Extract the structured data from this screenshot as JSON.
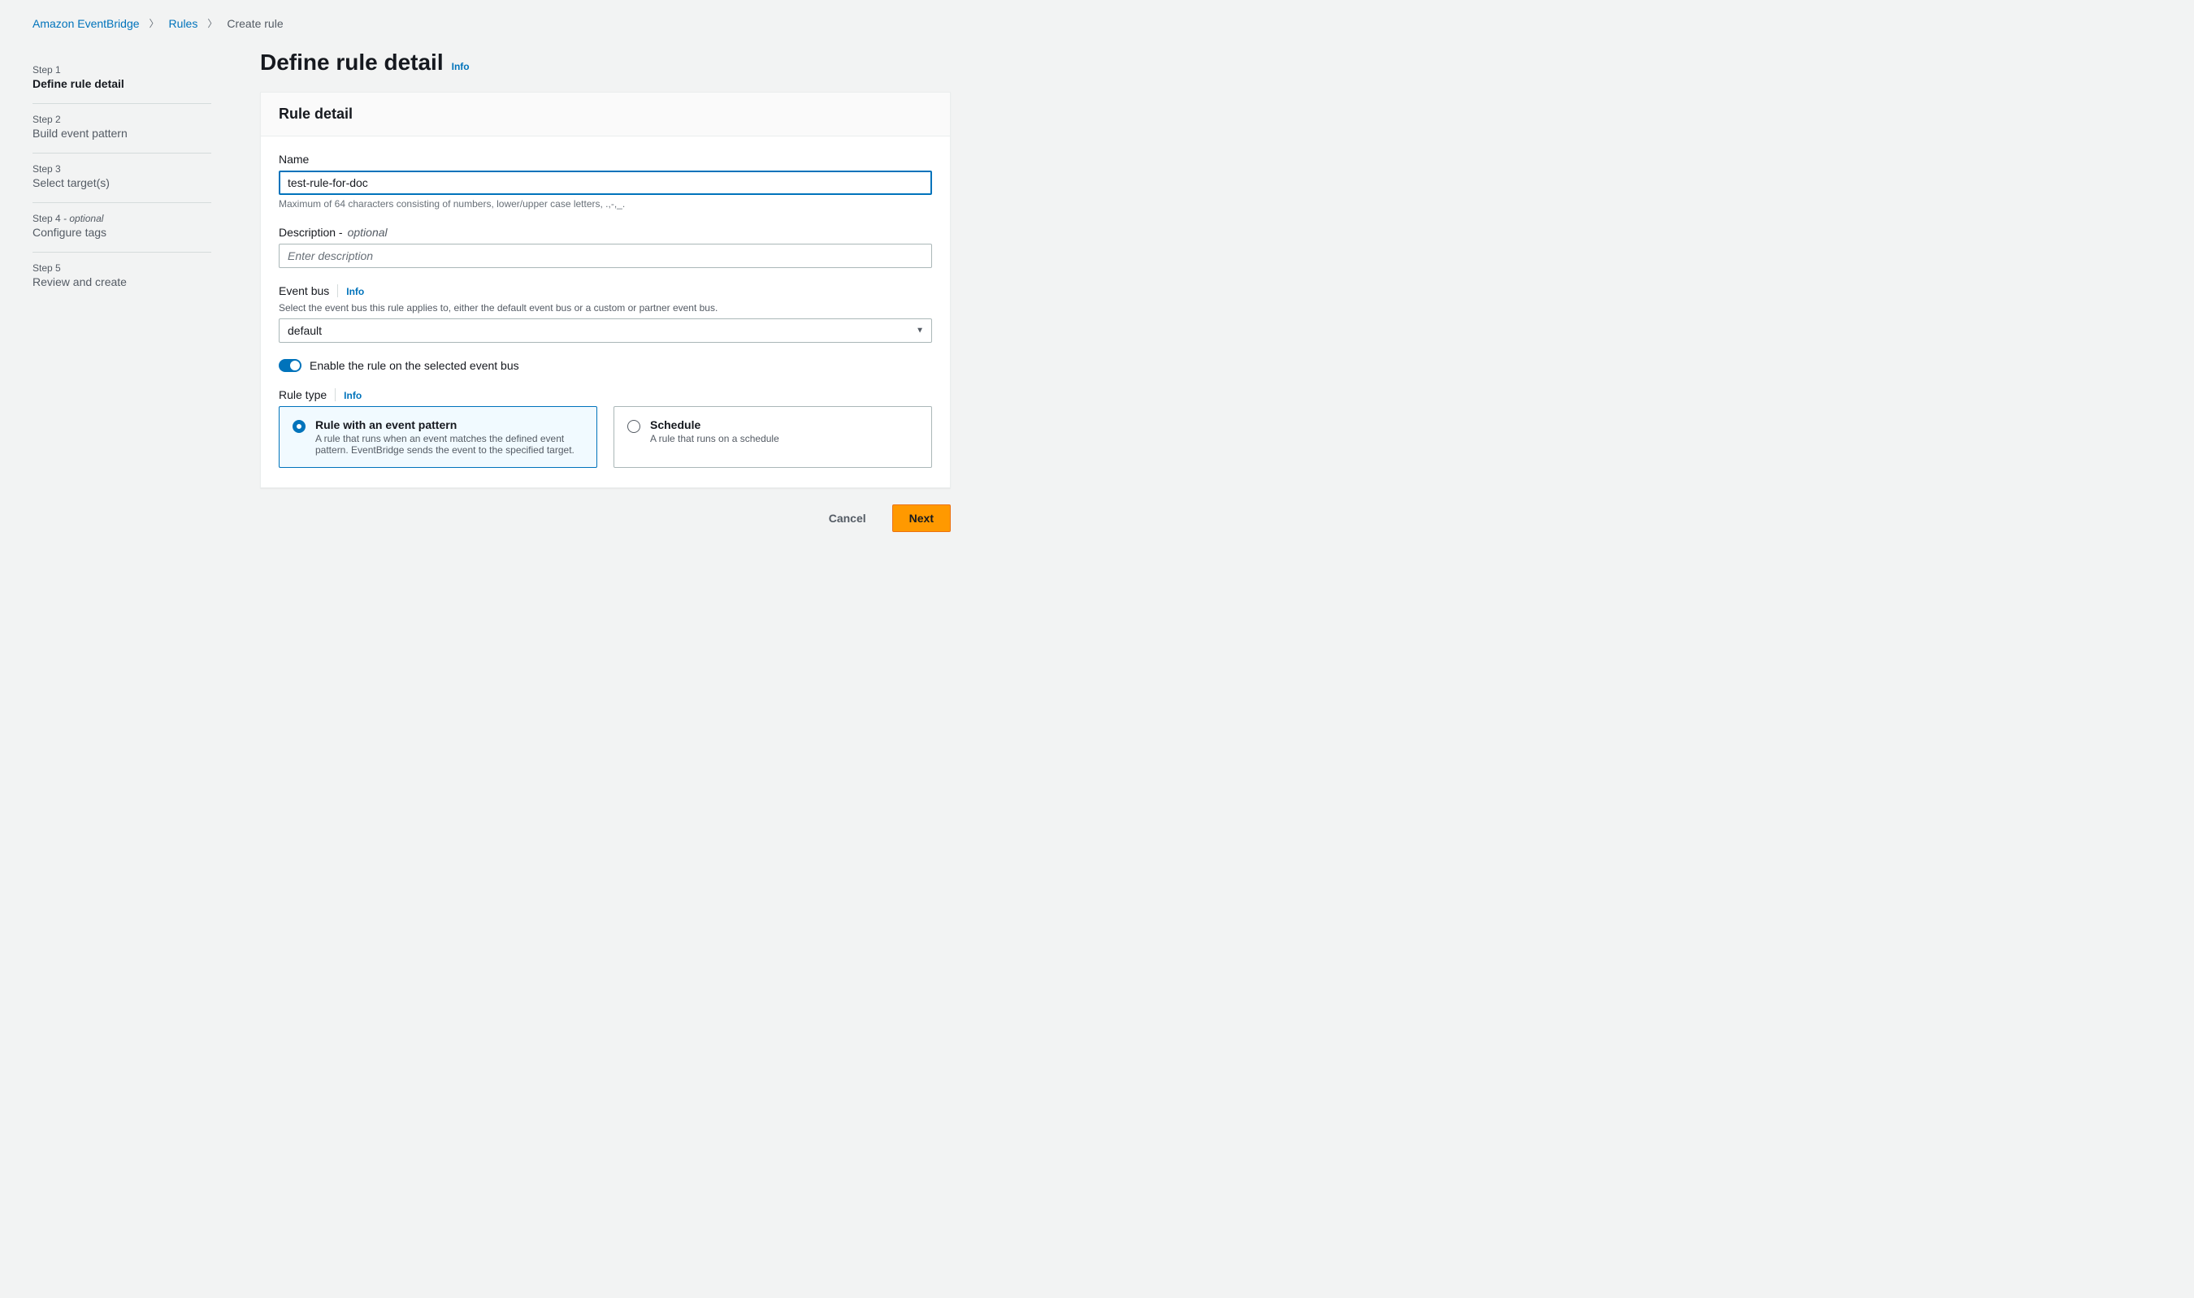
{
  "breadcrumb": {
    "items": [
      {
        "label": "Amazon EventBridge",
        "link": true
      },
      {
        "label": "Rules",
        "link": true
      },
      {
        "label": "Create rule",
        "link": false
      }
    ]
  },
  "steps": [
    {
      "label": "Step 1",
      "optional": "",
      "title": "Define rule detail",
      "active": true
    },
    {
      "label": "Step 2",
      "optional": "",
      "title": "Build event pattern",
      "active": false
    },
    {
      "label": "Step 3",
      "optional": "",
      "title": "Select target(s)",
      "active": false
    },
    {
      "label": "Step 4",
      "optional": " - optional",
      "title": "Configure tags",
      "active": false
    },
    {
      "label": "Step 5",
      "optional": "",
      "title": "Review and create",
      "active": false
    }
  ],
  "page": {
    "title": "Define rule detail",
    "info": "Info"
  },
  "panel": {
    "heading": "Rule detail",
    "name": {
      "label": "Name",
      "value": "test-rule-for-doc",
      "hint": "Maximum of 64 characters consisting of numbers, lower/upper case letters, .,-,_."
    },
    "description": {
      "label": "Description - ",
      "optional": "optional",
      "placeholder": "Enter description",
      "value": ""
    },
    "eventbus": {
      "label": "Event bus",
      "info": "Info",
      "desc": "Select the event bus this rule applies to, either the default event bus or a custom or partner event bus.",
      "value": "default"
    },
    "toggle": {
      "enabled": true,
      "label": "Enable the rule on the selected event bus"
    },
    "ruletype": {
      "label": "Rule type",
      "info": "Info",
      "options": [
        {
          "title": "Rule with an event pattern",
          "desc": "A rule that runs when an event matches the defined event pattern. EventBridge sends the event to the specified target.",
          "selected": true
        },
        {
          "title": "Schedule",
          "desc": "A rule that runs on a schedule",
          "selected": false
        }
      ]
    }
  },
  "actions": {
    "cancel": "Cancel",
    "next": "Next"
  }
}
